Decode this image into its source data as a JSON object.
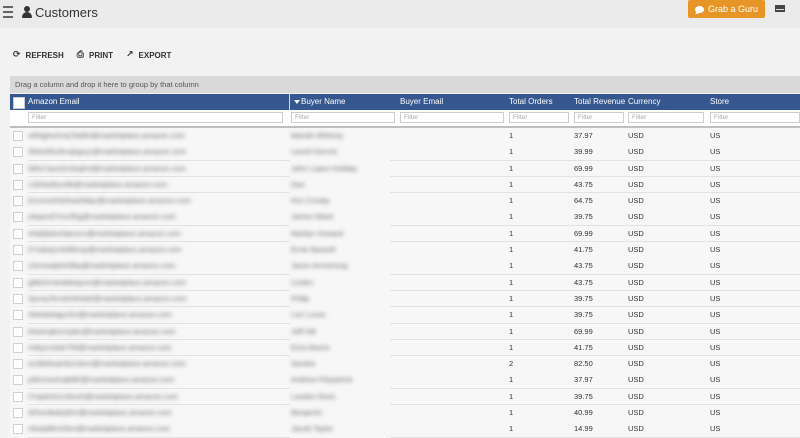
{
  "header": {
    "title": "Customers",
    "menu_icon": "hamburger-icon",
    "user_icon": "person-icon",
    "guru_button": "Grab a Guru",
    "guru_color": "#e89527",
    "mail_icon": "envelope-icon"
  },
  "toolbar": {
    "refresh": "REFRESH",
    "print": "PRINT",
    "export": "EXPORT"
  },
  "group_bar": "Drag a column and drop it here to group by that column",
  "columns": {
    "amazon_email": "Amazon Email",
    "buyer_name": "Buyer Name",
    "buyer_email": "Buyer Email",
    "total_orders": "Total Orders",
    "total_revenue": "Total Revenue",
    "currency": "Currency",
    "store": "Store"
  },
  "filter_placeholder": "Filter",
  "header_color": "#35568e",
  "rows": [
    {
      "email": "x8f4gkw2mq7bd9rt@marketplace.amazon.com",
      "name": "Mariah Whitney",
      "orders": "1",
      "revenue": "37.97",
      "currency": "USD",
      "store": "US"
    },
    {
      "email": "3hbn0tkv9rcq5gxyz@marketplace.amazon.com",
      "name": "Laurel Dennis",
      "orders": "1",
      "revenue": "39.99",
      "currency": "USD",
      "store": "US"
    },
    {
      "email": "9dhs7pw1kn3xqlmt@marketplace.amazon.com",
      "name": "John Lopez-Holiday",
      "orders": "1",
      "revenue": "69.99",
      "currency": "USD",
      "store": "US"
    },
    {
      "email": "c2k5tw8ryv6b@marketplace.amazon.com",
      "name": "Dan",
      "orders": "1",
      "revenue": "43.75",
      "currency": "USD",
      "store": "US"
    },
    {
      "email": "b1vmx4rt92hwe8dqc@marketplace.amazon.com",
      "name": "Kim Crosby",
      "orders": "1",
      "revenue": "64.75",
      "currency": "USD",
      "store": "US"
    },
    {
      "email": "y5qwnd7mz2lhg@marketplace.amazon.com",
      "name": "James Ward",
      "orders": "1",
      "revenue": "39.75",
      "currency": "USD",
      "store": "US"
    },
    {
      "email": "4rtkj8plxw3qmzcv@marketplace.amazon.com",
      "name": "Marilyn Howard",
      "orders": "1",
      "revenue": "69.99",
      "currency": "USD",
      "store": "US"
    },
    {
      "email": "h7xdwq1nkt9bsvp@marketplace.amazon.com",
      "name": "Ernie Bassett",
      "orders": "1",
      "revenue": "41.75",
      "currency": "USD",
      "store": "US"
    },
    {
      "email": "z3nmwq9xh5lkp@marketplace.amazon.com",
      "name": "Jason Armstrong",
      "orders": "1",
      "revenue": "43.75",
      "currency": "USD",
      "store": "US"
    },
    {
      "email": "g6bt2rmkx8dwqzvn@marketplace.amazon.com",
      "name": "Linden",
      "orders": "1",
      "revenue": "43.75",
      "currency": "USD",
      "store": "US"
    },
    {
      "email": "2pvxq7kmwh4tnbdr@marketplace.amazon.com",
      "name": "Philip",
      "orders": "1",
      "revenue": "39.75",
      "currency": "USD",
      "store": "US"
    },
    {
      "email": "r8xkdw5qpz3m@marketplace.amazon.com",
      "name": "Lori Lucas",
      "orders": "1",
      "revenue": "39.75",
      "currency": "USD",
      "store": "US"
    },
    {
      "email": "k4wtnq8xm2pbv@marketplace.amazon.com",
      "name": "Jeff Hill",
      "orders": "1",
      "revenue": "69.99",
      "currency": "USD",
      "store": "US"
    },
    {
      "email": "m9qzrx3wk7hlt@marketplace.amazon.com",
      "name": "Ezra Moore",
      "orders": "1",
      "revenue": "41.75",
      "currency": "USD",
      "store": "US"
    },
    {
      "email": "w1bkt6xqn9zmdvrs@marketplace.amazon.com",
      "name": "Sandra",
      "orders": "2",
      "revenue": "82.50",
      "currency": "USD",
      "store": "US"
    },
    {
      "email": "p5kmxw2rq8dth@marketplace.amazon.com",
      "name": "Andrew Fitzpatrick",
      "orders": "1",
      "revenue": "37.97",
      "currency": "USD",
      "store": "US"
    },
    {
      "email": "t7rqwk3mz1bnxh@marketplace.amazon.com",
      "name": "Landon Rees",
      "orders": "1",
      "revenue": "39.75",
      "currency": "USD",
      "store": "US"
    },
    {
      "email": "d2hxn8wkq5tm@marketplace.amazon.com",
      "name": "Benjamin",
      "orders": "1",
      "revenue": "40.99",
      "currency": "USD",
      "store": "US"
    },
    {
      "email": "n6wqt9kx3rbm@marketplace.amazon.com",
      "name": "Jacob Taylor",
      "orders": "1",
      "revenue": "14.99",
      "currency": "USD",
      "store": "US"
    }
  ]
}
